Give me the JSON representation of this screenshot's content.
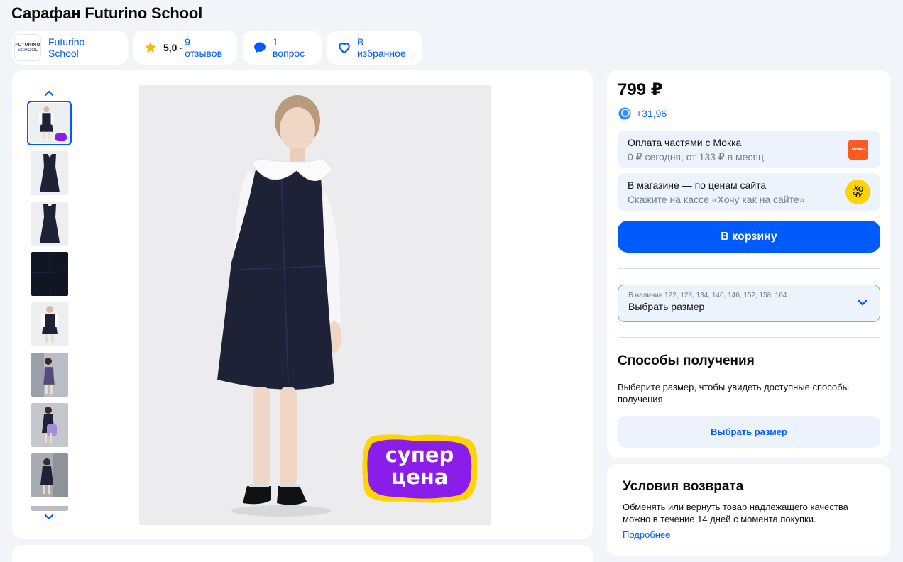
{
  "product": {
    "title": "Сарафан Futurino School"
  },
  "chips": {
    "brand_name": "Futurino School",
    "brand_logo_line1": "FUTURINO",
    "brand_logo_line2": "SCHOOL",
    "rating": "5,0",
    "rating_sep": "·",
    "reviews": "9 отзывов",
    "questions": "1 вопрос",
    "favorite": "В избранное"
  },
  "gallery": {
    "thumbnails": [
      {
        "kind": "photo-girl-front",
        "active": true
      },
      {
        "kind": "dress-front"
      },
      {
        "kind": "dress-back"
      },
      {
        "kind": "fabric-closeup"
      },
      {
        "kind": "photo-girl-white"
      },
      {
        "kind": "photo-girl-backpack"
      },
      {
        "kind": "photo-girl-backpack-2"
      },
      {
        "kind": "photo-girl-wall"
      },
      {
        "kind": "photo-girl-partial"
      }
    ],
    "badge_line1": "супер",
    "badge_line2": "цена"
  },
  "buy": {
    "price": "799 ₽",
    "bonus": "+31,96",
    "mokka": {
      "title": "Оплата частями с Мокка",
      "subtitle": "0 ₽ сегодня, от 133 ₽ в месяц",
      "logo_text": "Мокка"
    },
    "store": {
      "title": "В магазине — по ценам сайта",
      "subtitle": "Скажите на кассе «Хочу как на сайте»",
      "logo_text_1": "ХО",
      "logo_text_2": "ЧУ"
    },
    "cart_button": "В корзину",
    "size": {
      "available": "В наличии 122, 128, 134, 140, 146, 152, 158, 164",
      "placeholder": "Выбрать размер"
    },
    "delivery": {
      "heading": "Способы получения",
      "text": "Выберите размер, чтобы увидеть доступные способы получения",
      "button": "Выбрать размер"
    }
  },
  "returns": {
    "heading": "Условия возврата",
    "text": "Обменять или вернуть товар надлежащего качества можно в течение 14 дней с момента покупки.",
    "link": "Подробнее"
  },
  "colors": {
    "accent": "#005bff",
    "page_bg": "#f1f4f8",
    "info_bg": "#ecf3fd",
    "dress_navy": "#1d2236",
    "badge_purple": "#8b1dea",
    "badge_yellow": "#ffd400"
  }
}
